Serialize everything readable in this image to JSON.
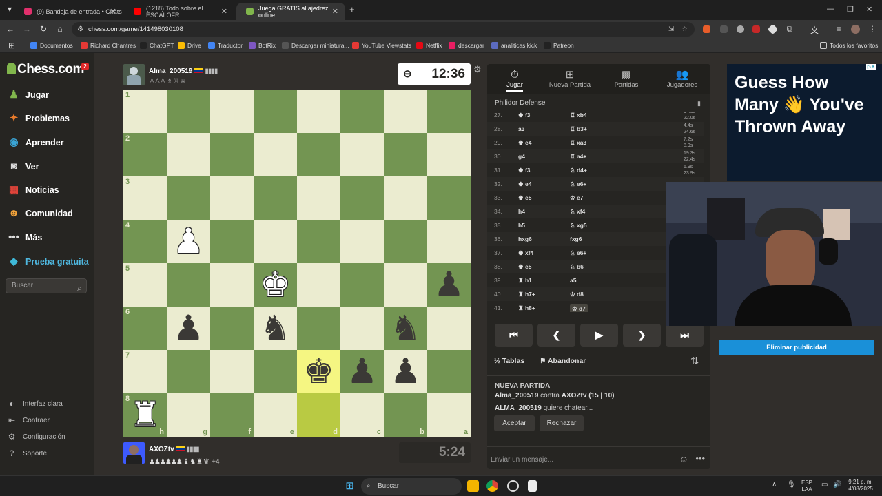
{
  "browser": {
    "tabs": [
      {
        "title": "(9) Bandeja de entrada • Chats",
        "fav_color": "#e1306c",
        "active": false
      },
      {
        "title": "(1218) Todo sobre el ESCALOFR",
        "fav_color": "#ff0000",
        "active": false
      },
      {
        "title": "Juega GRATIS al ajedrez online",
        "fav_color": "#81b64c",
        "active": true
      }
    ],
    "new_tab": "+",
    "url": "chess.com/game/141498030108",
    "bookmarks": [
      {
        "label": "Documentos",
        "color": "#4285f4"
      },
      {
        "label": "Richard Chantres",
        "color": "#e53935"
      },
      {
        "label": "ChatGPT",
        "color": "#222"
      },
      {
        "label": "Drive",
        "color": "#fbbc04"
      },
      {
        "label": "Traductor",
        "color": "#4285f4"
      },
      {
        "label": "BotRix",
        "color": "#7e57c2"
      },
      {
        "label": "Descargar miniatura...",
        "color": "#555"
      },
      {
        "label": "YouTube Viewstats",
        "color": "#e53935"
      },
      {
        "label": "Netflix",
        "color": "#e50914"
      },
      {
        "label": "descargar",
        "color": "#e91e63"
      },
      {
        "label": "analiticas kick",
        "color": "#5c6bc0"
      },
      {
        "label": "Patreon",
        "color": "#222"
      }
    ],
    "all_bookmarks": "Todos los favoritos"
  },
  "sidenav": {
    "logo": "Chess.com",
    "badge": "2",
    "items": [
      {
        "label": "Jugar",
        "icon": "♟",
        "color": "#81b64c"
      },
      {
        "label": "Problemas",
        "icon": "✦",
        "color": "#e97b2b"
      },
      {
        "label": "Aprender",
        "icon": "◉",
        "color": "#3aa5d6"
      },
      {
        "label": "Ver",
        "icon": "◙",
        "color": "#ddd"
      },
      {
        "label": "Noticias",
        "icon": "▦",
        "color": "#e0443a"
      },
      {
        "label": "Comunidad",
        "icon": "☻",
        "color": "#f2a33a"
      },
      {
        "label": "Más",
        "icon": "•••",
        "color": "#ddd"
      },
      {
        "label": "Prueba gratuita",
        "icon": "◆",
        "color": "#3fb9d8"
      }
    ],
    "search_placeholder": "Buscar",
    "bottom": [
      {
        "label": "Interfaz clara",
        "icon": "◐"
      },
      {
        "label": "Contraer",
        "icon": "⇤"
      },
      {
        "label": "Configuración",
        "icon": "⚙"
      },
      {
        "label": "Soporte",
        "icon": "?"
      }
    ]
  },
  "game": {
    "top_player": {
      "name": "Alma_200519",
      "captures": "♙♙♙ ♗ ♖ ♕",
      "clock": "12:36"
    },
    "bottom_player": {
      "name": "AXOZtv",
      "captures": "♟♟♟♟♟♟ ♝ ♞ ♜ ♛",
      "extra": "+4",
      "clock": "5:24"
    },
    "ranks": [
      "1",
      "2",
      "3",
      "4",
      "5",
      "6",
      "7",
      "8"
    ],
    "files": [
      "h",
      "g",
      "f",
      "e",
      "d",
      "c",
      "b",
      "a"
    ],
    "highlight": [
      "d7",
      "d8"
    ],
    "pieces": [
      {
        "square": "g4",
        "glyph": "♟",
        "side": "w"
      },
      {
        "square": "e5",
        "glyph": "♚",
        "side": "w"
      },
      {
        "square": "a5",
        "glyph": "♟",
        "side": "b"
      },
      {
        "square": "g6",
        "glyph": "♟",
        "side": "b"
      },
      {
        "square": "e6",
        "glyph": "♞",
        "side": "b"
      },
      {
        "square": "b6",
        "glyph": "♞",
        "side": "b"
      },
      {
        "square": "d7",
        "glyph": "♚",
        "side": "b"
      },
      {
        "square": "c7",
        "glyph": "♟",
        "side": "b"
      },
      {
        "square": "b7",
        "glyph": "♟",
        "side": "b"
      },
      {
        "square": "h8",
        "glyph": "♜",
        "side": "w"
      }
    ]
  },
  "panel": {
    "tabs": [
      {
        "label": "Jugar",
        "icon": "⏱",
        "active": true
      },
      {
        "label": "Nueva Partida",
        "icon": "⊞",
        "active": false
      },
      {
        "label": "Partidas",
        "icon": "▩",
        "active": false
      },
      {
        "label": "Jugadores",
        "icon": "👥",
        "active": false
      }
    ],
    "opening": "Philidor Defense",
    "moves": [
      {
        "n": "27.",
        "w": "♚ f3",
        "b": "♖ xb4",
        "t1": "14.5s",
        "t2": "22.0s"
      },
      {
        "n": "28.",
        "w": "a3",
        "b": "♖ b3+",
        "t1": "4.4s",
        "t2": "24.6s"
      },
      {
        "n": "29.",
        "w": "♚ e4",
        "b": "♖ xa3",
        "t1": "7.2s",
        "t2": "8.9s"
      },
      {
        "n": "30.",
        "w": "g4",
        "b": "♖ a4+",
        "t1": "19.3s",
        "t2": "22.4s"
      },
      {
        "n": "31.",
        "w": "♚ f3",
        "b": "♘ d4+",
        "t1": "6.9s",
        "t2": "23.9s"
      },
      {
        "n": "32.",
        "w": "♚ e4",
        "b": "♘ e6+",
        "t1": "",
        "t2": ""
      },
      {
        "n": "33.",
        "w": "♚ e5",
        "b": "♔ e7",
        "t1": "",
        "t2": ""
      },
      {
        "n": "34.",
        "w": "h4",
        "b": "♘ xf4",
        "t1": "",
        "t2": ""
      },
      {
        "n": "35.",
        "w": "h5",
        "b": "♘ xg5",
        "t1": "",
        "t2": ""
      },
      {
        "n": "36.",
        "w": "hxg6",
        "b": "fxg6",
        "t1": "",
        "t2": ""
      },
      {
        "n": "37.",
        "w": "♚ xf4",
        "b": "♘ e6+",
        "t1": "",
        "t2": ""
      },
      {
        "n": "38.",
        "w": "♚ e5",
        "b": "♘ b6",
        "t1": "",
        "t2": ""
      },
      {
        "n": "39.",
        "w": "♜ h1",
        "b": "a5",
        "t1": "",
        "t2": ""
      },
      {
        "n": "40.",
        "w": "♜ h7+",
        "b": "♔ d8",
        "t1": "",
        "t2": ""
      },
      {
        "n": "41.",
        "w": "♜ h8+",
        "b": "♔ d7",
        "t1": "",
        "t2": ""
      }
    ],
    "controls": [
      "⏮",
      "❮",
      "▶",
      "❯",
      "⏭"
    ],
    "draw": "Tablas",
    "resign": "Abandonar",
    "chat": {
      "header": "NUEVA PARTIDA",
      "line1_a": "Alma_200519",
      "line1_b": "contra",
      "line1_c": "AXOZtv (15 | 10)",
      "line2_a": "ALMA_200519",
      "line2_b": "quiere chatear...",
      "accept": "Aceptar",
      "reject": "Rechazar",
      "placeholder": "Enviar un mensaje..."
    }
  },
  "ad": {
    "text": "Guess How Many 👋 You've Thrown Away",
    "remove": "Eliminar publicidad"
  },
  "taskbar": {
    "search": "Buscar",
    "lang1": "ESP",
    "lang2": "LAA",
    "time": "9:21 p. m.",
    "date": "4/08/2025"
  }
}
